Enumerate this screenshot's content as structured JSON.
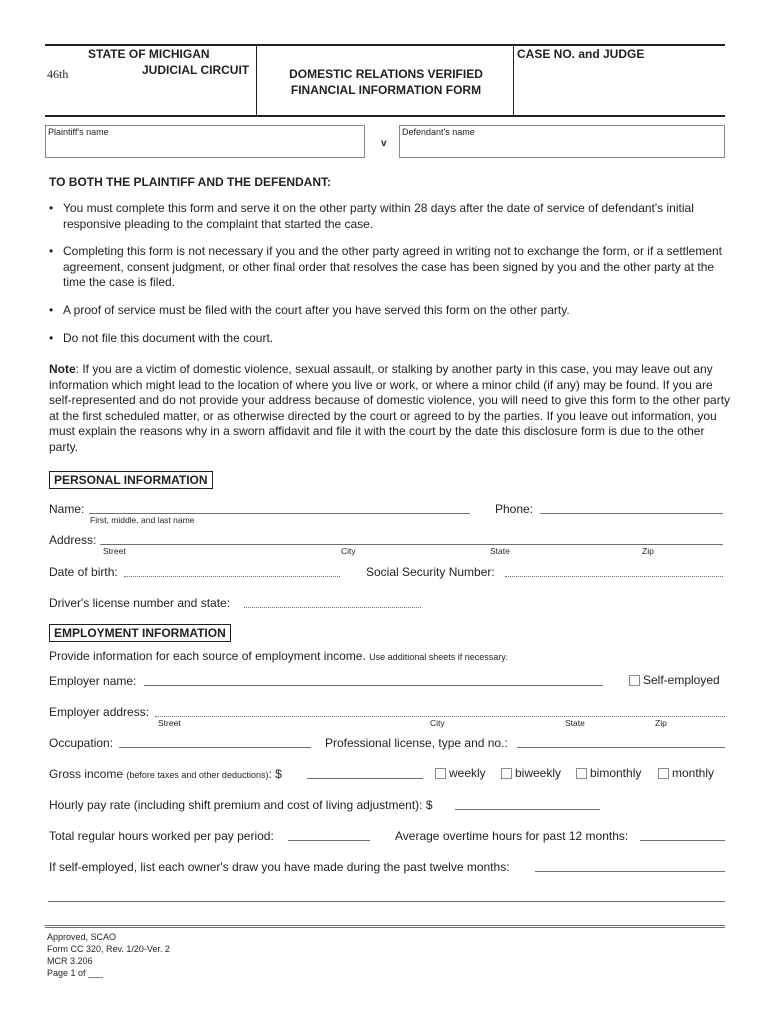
{
  "header": {
    "state": "STATE OF MICHIGAN",
    "circuit_number": "46th",
    "circuit_label": "JUDICIAL CIRCUIT",
    "form_title_line1": "DOMESTIC RELATIONS VERIFIED",
    "form_title_line2": "FINANCIAL INFORMATION FORM",
    "case_no_label": "CASE NO. and JUDGE"
  },
  "parties": {
    "plaintiff_label": "Plaintiff's name",
    "plaintiff_value": "",
    "versus": "v",
    "defendant_label": "Defendant's name",
    "defendant_value": ""
  },
  "instructions": {
    "heading": "TO BOTH THE PLAINTIFF AND THE DEFENDANT:",
    "bullet_char": "•",
    "bullets": [
      "You must complete this form and serve it on the other party within 28 days after the date of service of defendant's initial responsive pleading to the complaint that started the case.",
      "Completing this form is not necessary if you and the other party agreed in writing not to exchange the form, or if a settlement agreement, consent judgment, or other final order that resolves the case has been signed by you and the other party at the time the case is filed.",
      "A proof of service must be filed with the court after you have served this form on the other party.",
      "Do not file this document with the court."
    ],
    "note_label": "Note",
    "note_text": ":  If you are a victim of domestic violence, sexual assault, or stalking by another party in this case, you may leave out any information which might lead to the location of where you live or work, or where a minor child (if any) may be found. If you are self-represented and do not provide your address because of domestic violence, you will need to give this form to the other party at the first scheduled matter, or as otherwise directed by the court or agreed to by the parties.  If you leave out information, you must explain the reasons why in a sworn affidavit and file it with the court by the date this disclosure form is due to the other party."
  },
  "personal": {
    "heading": "PERSONAL INFORMATION",
    "name_label": "Name:",
    "name_hint": "First, middle, and last name",
    "name_value": "",
    "phone_label": "Phone:",
    "phone_value": "",
    "address_label": "Address:",
    "address_value": "",
    "address_hints": [
      "Street",
      "City",
      "State",
      "Zip"
    ],
    "dob_label": "Date of birth:",
    "dob_value": "",
    "ssn_label": "Social Security Number:",
    "ssn_value": "",
    "dl_label": "Driver's license number and state:",
    "dl_value": ""
  },
  "employment": {
    "heading": "EMPLOYMENT INFORMATION",
    "intro": "Provide information for each source of employment income.",
    "intro_small": "Use additional sheets if necessary.",
    "employer_name_label": "Employer name:",
    "employer_name_value": "",
    "self_employed_label": "Self-employed",
    "self_employed_checked": false,
    "employer_address_label": "Employer address:",
    "employer_address_value": "",
    "employer_address_hints": [
      "Street",
      "City",
      "State",
      "Zip"
    ],
    "occupation_label": "Occupation:",
    "occupation_value": "",
    "license_label": "Professional license, type and no.:",
    "license_value": "",
    "gross_label": "Gross income",
    "gross_small": "(before taxes and other deductions)",
    "gross_suffix": ": $",
    "gross_value": "",
    "frequency_options": [
      {
        "label": "weekly",
        "checked": false
      },
      {
        "label": "biweekly",
        "checked": false
      },
      {
        "label": "bimonthly",
        "checked": false
      },
      {
        "label": "monthly",
        "checked": false
      }
    ],
    "hourly_label": "Hourly pay rate (including shift premium and cost of living adjustment): $",
    "hourly_value": "",
    "regular_hours_label": "Total regular hours worked per pay period:",
    "regular_hours_value": "",
    "overtime_label": "Average overtime hours for past 12 months:",
    "overtime_value": "",
    "owners_draw_label": "If self-employed, list each owner's draw you have made during the past twelve months:",
    "owners_draw_value": ""
  },
  "footer": {
    "approved": "Approved, SCAO",
    "form_id": "Form CC 320, Rev. 1/20-Ver. 2",
    "rule": "MCR 3.206",
    "page": "Page 1 of ___"
  }
}
